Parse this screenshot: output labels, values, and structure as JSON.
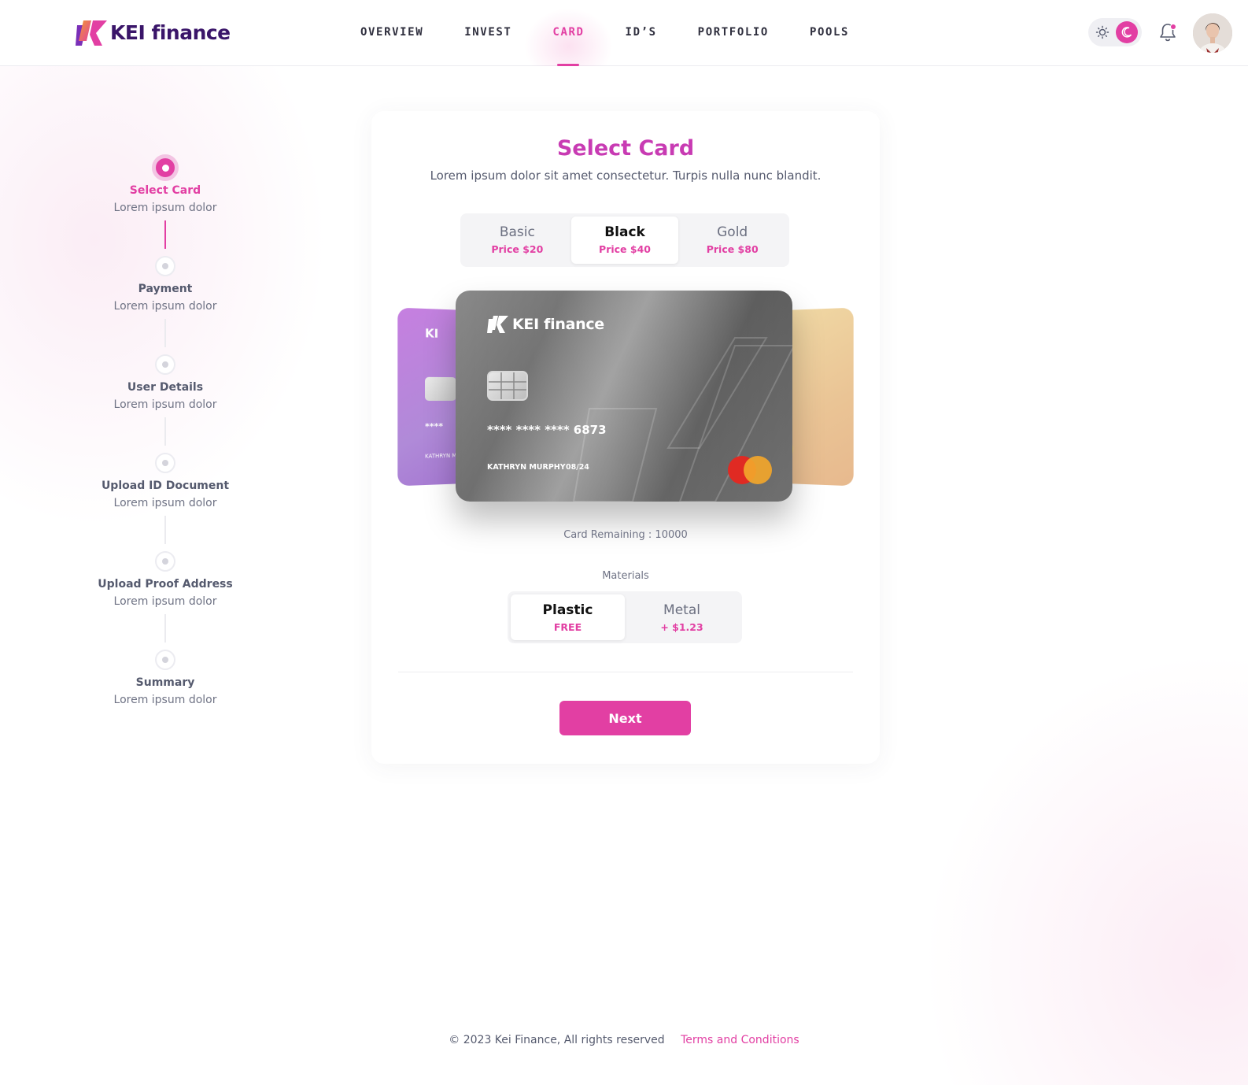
{
  "brand": {
    "name": "KEI finance",
    "accent": "#e23fa3"
  },
  "nav": {
    "items": [
      {
        "label": "OVERVIEW"
      },
      {
        "label": "INVEST"
      },
      {
        "label": "CARD"
      },
      {
        "label": "ID’S"
      },
      {
        "label": "PORTFOLIO"
      },
      {
        "label": "POOLS"
      }
    ],
    "active": "CARD"
  },
  "header": {
    "theme": "dark-selected",
    "notifications": true
  },
  "stepper": {
    "steps": [
      {
        "title": "Select Card",
        "subtitle": "Lorem ipsum dolor"
      },
      {
        "title": "Payment",
        "subtitle": "Lorem ipsum dolor"
      },
      {
        "title": "User Details",
        "subtitle": "Lorem ipsum dolor"
      },
      {
        "title": "Upload ID Document",
        "subtitle": "Lorem ipsum dolor"
      },
      {
        "title": "Upload Proof Address",
        "subtitle": "Lorem ipsum dolor"
      },
      {
        "title": "Summary",
        "subtitle": "Lorem ipsum dolor"
      }
    ],
    "active_index": 0
  },
  "panel": {
    "title": "Select Card",
    "subtitle": "Lorem ipsum dolor sit amet consectetur. Turpis nulla nunc blandit.",
    "tiers": [
      {
        "name": "Basic",
        "price": "Price $20"
      },
      {
        "name": "Black",
        "price": "Price $40"
      },
      {
        "name": "Gold",
        "price": "Price $80"
      }
    ],
    "selected_tier": "Black",
    "card": {
      "brand": "KEI finance",
      "number": "**** **** **** 6873",
      "holder": "KATHRYN MURPHY",
      "expiry": "08/24",
      "side_brand": "KI",
      "side_stars": "****",
      "side_holder": "KATHRYN M"
    },
    "remaining": "Card Remaining : 10000",
    "materials_label": "Materials",
    "materials": [
      {
        "name": "Plastic",
        "price": "FREE"
      },
      {
        "name": "Metal",
        "price": "+ $1.23"
      }
    ],
    "selected_material": "Plastic",
    "next_label": "Next"
  },
  "footer": {
    "copyright": "© 2023 Kei Finance, All rights reserved",
    "terms": "Terms and Conditions"
  }
}
